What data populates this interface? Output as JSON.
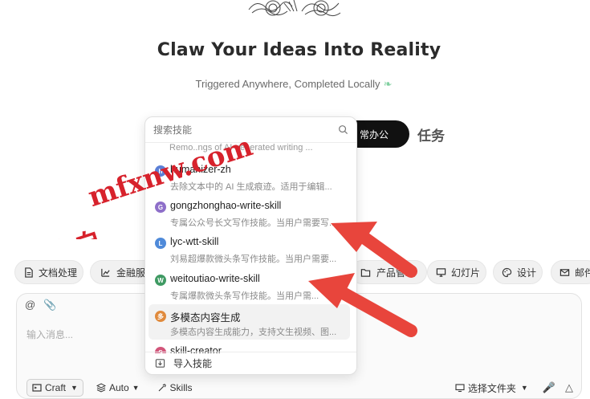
{
  "hero": {
    "title": "Claw Your Ideas Into Reality",
    "subtitle": "Triggered Anywhere, Completed Locally",
    "leaf_icon": "leaf-icon"
  },
  "mode": {
    "active_label": "常办公",
    "tab_label": "任务"
  },
  "skill_dropdown": {
    "search_placeholder": "搜索技能",
    "cut_text": "Remo..ngs of AI-generated writing ...",
    "items": [
      {
        "avatar": "h",
        "color": "#5b7fd6",
        "name": "humanizer-zh",
        "desc": "去除文本中的 AI 生成痕迹。适用于编辑..."
      },
      {
        "avatar": "G",
        "color": "#8e6fc9",
        "name": "gongzhonghao-write-skill",
        "desc": "专属公众号长文写作技能。当用户需要写..."
      },
      {
        "avatar": "L",
        "color": "#4f8ad9",
        "name": "lyc-wtt-skill",
        "desc": "刘易超爆款微头条写作技能。当用户需要..."
      },
      {
        "avatar": "W",
        "color": "#3f9a63",
        "name": "weitoutiao-write-skill",
        "desc": "专属爆款微头条写作技能。当用户需..."
      },
      {
        "avatar": "多",
        "color": "#e08a3c",
        "name": "多模态内容生成",
        "desc": "多模态内容生成能力，支持文生视频、图..."
      },
      {
        "avatar": "S",
        "color": "#d2557a",
        "name": "skill-creator",
        "desc": ""
      }
    ],
    "footer_label": "导入技能"
  },
  "chips": [
    {
      "label": "文档处理",
      "icon": "document-icon"
    },
    {
      "label": "金融服务",
      "icon": "chart-icon"
    },
    {
      "label": "产品管理",
      "icon": "folder-icon"
    },
    {
      "label": "幻灯片",
      "icon": "monitor-icon"
    },
    {
      "label": "设计",
      "icon": "palette-icon"
    },
    {
      "label": "邮件",
      "icon": "mail-icon"
    }
  ],
  "composer": {
    "placeholder": "输入消息...",
    "craft_label": "Craft",
    "auto_label": "Auto",
    "skills_label": "Skills",
    "folder_label": "选择文件夹"
  },
  "watermark": {
    "site": "mfxnw.com",
    "prefix": "源来自"
  }
}
